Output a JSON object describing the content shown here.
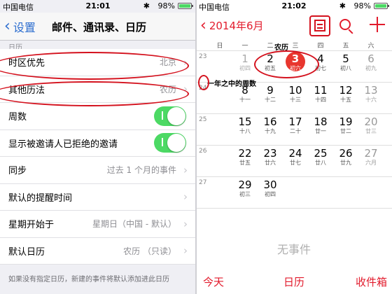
{
  "left": {
    "status": {
      "carrier": "中国电信",
      "time": "21:01",
      "battery": "98%",
      "battery_level": 0.98
    },
    "nav": {
      "back_label": "设置",
      "title": "邮件、通讯录、日历"
    },
    "section_label": "日历",
    "rows": [
      {
        "label": "时区优先",
        "value": "北京",
        "type": "arrow"
      },
      {
        "label": "其他历法",
        "value": "农历",
        "type": "arrow"
      },
      {
        "label": "周数",
        "value": "",
        "type": "toggle"
      },
      {
        "label": "显示被邀请人已拒绝的邀请",
        "value": "",
        "type": "toggle"
      },
      {
        "label": "同步",
        "value": "过去 1 个月的事件",
        "type": "arrow"
      },
      {
        "label": "默认的提醒时间",
        "value": "",
        "type": "arrow"
      },
      {
        "label": "星期开始于",
        "value": "星期日（中国 - 默认）",
        "type": "arrow"
      },
      {
        "label": "默认日历",
        "value": "农历 （只读）",
        "type": "arrow"
      }
    ],
    "footnote": "如果没有指定日历，新建的事件将默认添加进此日历"
  },
  "right": {
    "status": {
      "carrier": "中国电信",
      "time": "21:02",
      "battery": "98%",
      "battery_level": 0.98
    },
    "nav": {
      "back_label": "2014年6月"
    },
    "weekdays": [
      "日",
      "一",
      "二",
      "三",
      "四",
      "五",
      "六"
    ],
    "lunar_label": "农历",
    "week_label": "一年之中的周数",
    "week_numbers": [
      "23",
      "24",
      "25",
      "26",
      "27"
    ],
    "calendar": [
      [
        {
          "d": "1",
          "l": "初四"
        },
        {
          "d": "2",
          "l": "初五"
        },
        {
          "d": "3",
          "l": "初六"
        },
        {
          "d": "4",
          "l": "初七"
        },
        {
          "d": "5",
          "l": "初八"
        },
        {
          "d": "6",
          "l": "初九"
        }
      ],
      [
        {
          "d": "8",
          "l": "十一"
        },
        {
          "d": "9",
          "l": "十二"
        },
        {
          "d": "10",
          "l": "十三"
        },
        {
          "d": "11",
          "l": "十四"
        },
        {
          "d": "12",
          "l": "十五"
        },
        {
          "d": "13",
          "l": "十六"
        }
      ],
      [
        {
          "d": "15",
          "l": "十八"
        },
        {
          "d": "16",
          "l": "十九"
        },
        {
          "d": "17",
          "l": "二十"
        },
        {
          "d": "18",
          "l": "廿一"
        },
        {
          "d": "19",
          "l": "廿二"
        },
        {
          "d": "20",
          "l": "廿三"
        }
      ],
      [
        {
          "d": "22",
          "l": "廿五"
        },
        {
          "d": "23",
          "l": "廿六"
        },
        {
          "d": "24",
          "l": "廿七"
        },
        {
          "d": "25",
          "l": "廿八"
        },
        {
          "d": "26",
          "l": "廿九"
        },
        {
          "d": "27",
          "l": "六月"
        },
        {
          "d": "28",
          "l": "初二"
        }
      ],
      [
        {
          "d": "29",
          "l": "初三"
        },
        {
          "d": "30",
          "l": "初四"
        }
      ]
    ],
    "no_events": "无事件",
    "tabs": [
      "今天",
      "日历",
      "收件箱"
    ]
  },
  "colors": {
    "accent_blue": "#2d6ecf",
    "accent_red": "#e21b2c",
    "toggle_green": "#4cd964",
    "highlight_oval": "#d4121e"
  }
}
